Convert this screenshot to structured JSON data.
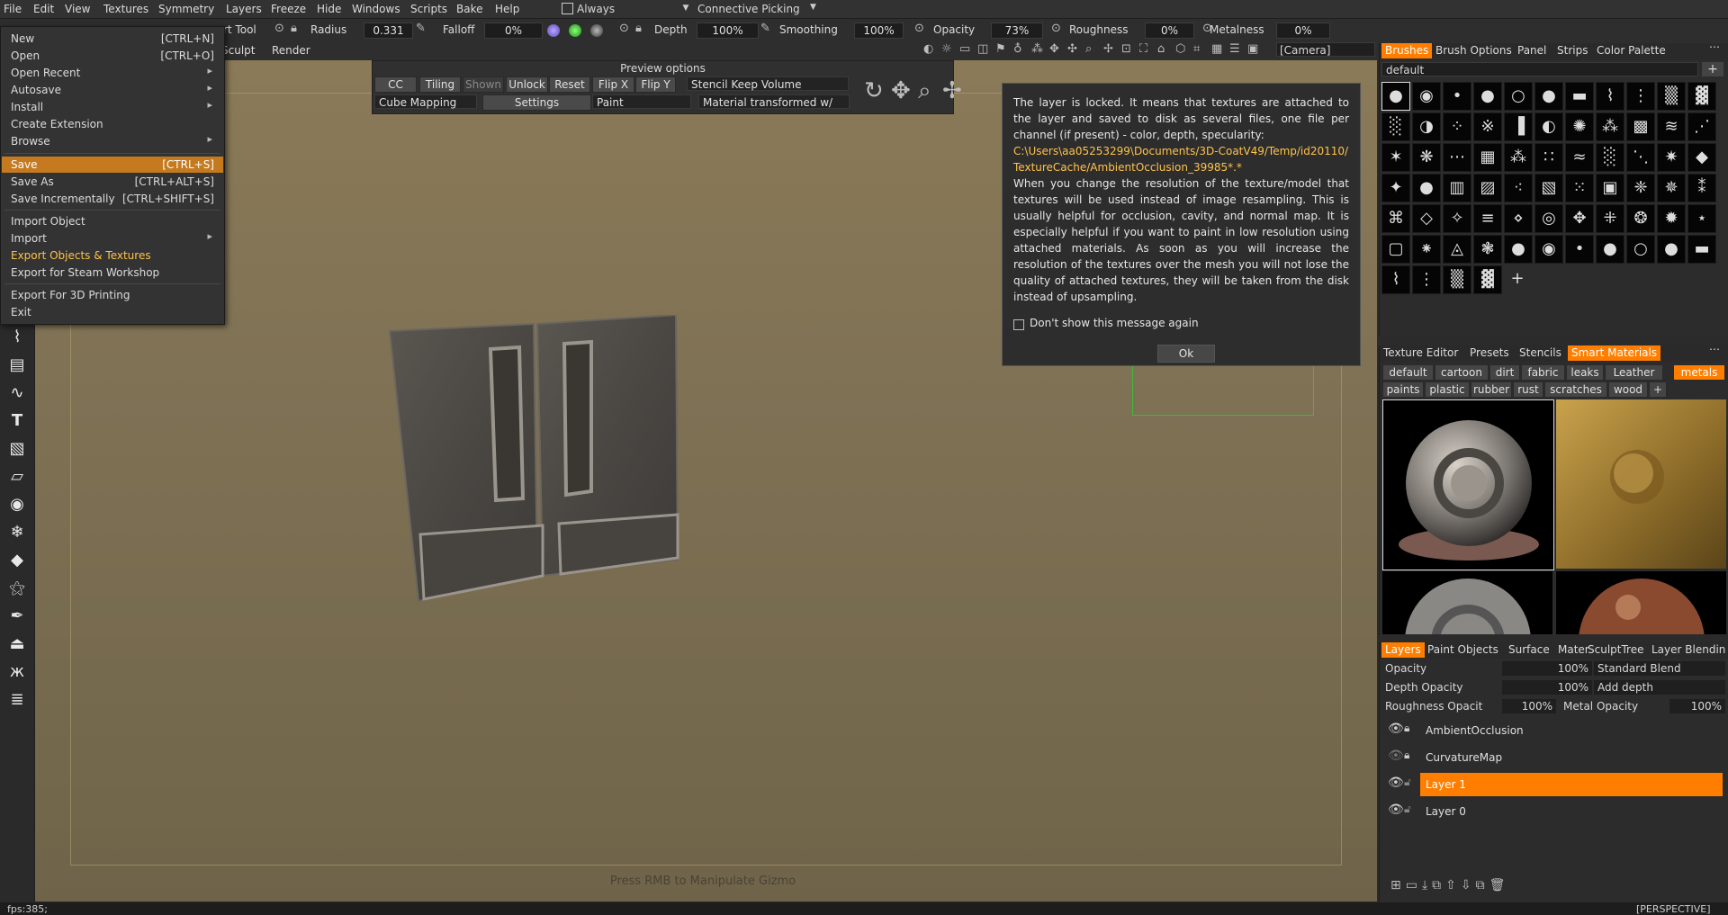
{
  "menubar": [
    "File",
    "Edit",
    "View",
    "Textures",
    "Symmetry",
    "Layers",
    "Freeze",
    "Hide",
    "Windows",
    "Scripts",
    "Bake",
    "Help"
  ],
  "picking": {
    "always_label": "Always",
    "mode": "Connective Picking"
  },
  "toolbar": {
    "tool_label": "rt  Tool",
    "radius_label": "Radius",
    "radius_value": "0.331",
    "falloff_label": "Falloff",
    "falloff_value": "0%",
    "depth_label": "Depth",
    "depth_value": "100%",
    "smoothing_label": "Smoothing",
    "smoothing_value": "100%",
    "opacity_label": "Opacity",
    "opacity_value": "73%",
    "roughness_label": "Roughness",
    "roughness_value": "0%",
    "metalness_label": "Metalness",
    "metalness_value": "0%",
    "sculpt_label": "Sculpt",
    "render_label": "Render",
    "camera_value": "[Camera]"
  },
  "file_menu": {
    "items": [
      {
        "label": "New",
        "shortcut": "[CTRL+N]"
      },
      {
        "label": "Open",
        "shortcut": "[CTRL+O]"
      },
      {
        "label": "Open Recent",
        "shortcut": ""
      },
      {
        "label": "Autosave",
        "shortcut": ""
      },
      {
        "label": "Install",
        "shortcut": ""
      },
      {
        "label": "Create Extension",
        "shortcut": ""
      },
      {
        "label": "Browse",
        "shortcut": ""
      },
      {
        "label": "Save",
        "shortcut": "[CTRL+S]"
      },
      {
        "label": "Save As",
        "shortcut": "[CTRL+ALT+S]"
      },
      {
        "label": "Save Incrementally",
        "shortcut": "[CTRL+SHIFT+S]"
      },
      {
        "label": "Import Object",
        "shortcut": ""
      },
      {
        "label": "Import",
        "shortcut": ""
      },
      {
        "label": "Export Objects & Textures",
        "shortcut": ""
      },
      {
        "label": "Export for Steam Workshop",
        "shortcut": ""
      },
      {
        "label": "Export For 3D Printing",
        "shortcut": ""
      },
      {
        "label": "Exit",
        "shortcut": ""
      }
    ]
  },
  "preview": {
    "title": "Preview options",
    "buttons": [
      "CC",
      "Tiling",
      "Shown",
      "Unlock",
      "Reset",
      "Flip X",
      "Flip Y"
    ],
    "stencil": "Stencil Keep Volume",
    "mapping": "Cube Mapping",
    "settings": "Settings",
    "paint": "Paint",
    "material": "Material transformed w/"
  },
  "tooltip": {
    "p1": "The layer is locked. It means that textures are attached to the layer and saved to disk as several files, one file per channel (if present) - color, depth, specularity:",
    "path": "C:\\Users\\aa05253299\\Documents/3D-CoatV49/Temp/id20110/TextureCache/AmbientOcclusion_39985*.*",
    "p2": "When you change the resolution of the texture/model that textures will be used instead of image resampling. This is usually helpful for occlusion, cavity, and normal map. It is especially helpful if you want to paint in low resolution using attached materials. As soon as you will increase the resolution of the textures over the mesh you will not lose the quality of attached textures, they will be taken from the disk instead of upsampling.",
    "checkbox": "Don't show this message again",
    "ok": "Ok"
  },
  "brushes_panel": {
    "tabs": [
      "Brushes",
      "Brush Options",
      "Panel",
      "Strips",
      "Color Palette"
    ],
    "preset": "default"
  },
  "smart_materials": {
    "tabs": [
      "Texture Editor",
      "Presets",
      "Stencils",
      "Smart Materials"
    ],
    "row1": [
      "default",
      "cartoon",
      "dirt",
      "fabric",
      "leaks",
      "Leather",
      "metals"
    ],
    "row2": [
      "paints",
      "plastic",
      "rubber",
      "rust",
      "scratches",
      "wood"
    ]
  },
  "layers_panel": {
    "tabs": [
      "Layers",
      "Paint Objects",
      "Surface",
      "Mater",
      "SculptTree",
      "Layer Blendin"
    ],
    "opacity_label": "Opacity",
    "opacity_value": "100%",
    "blend": "Standard Blend",
    "depth_label": "Depth Opacity",
    "depth_value": "100%",
    "depth_mode": "Add depth",
    "rough_label": "Roughness Opacit",
    "rough_value": "100%",
    "metal_label": "Metal Opacity",
    "metal_value": "100%",
    "layers": [
      "AmbientOcclusion",
      "CurvatureMap",
      "Layer 1",
      "Layer 0"
    ]
  },
  "viewport": {
    "hint": "Press RMB to Manipulate Gizmo"
  },
  "status": {
    "fps": "fps:385;",
    "view": "[PERSPECTIVE]"
  },
  "colors": {
    "accent": "#ff7e00",
    "highlight": "#c57a1f",
    "path": "#ffc24a"
  }
}
